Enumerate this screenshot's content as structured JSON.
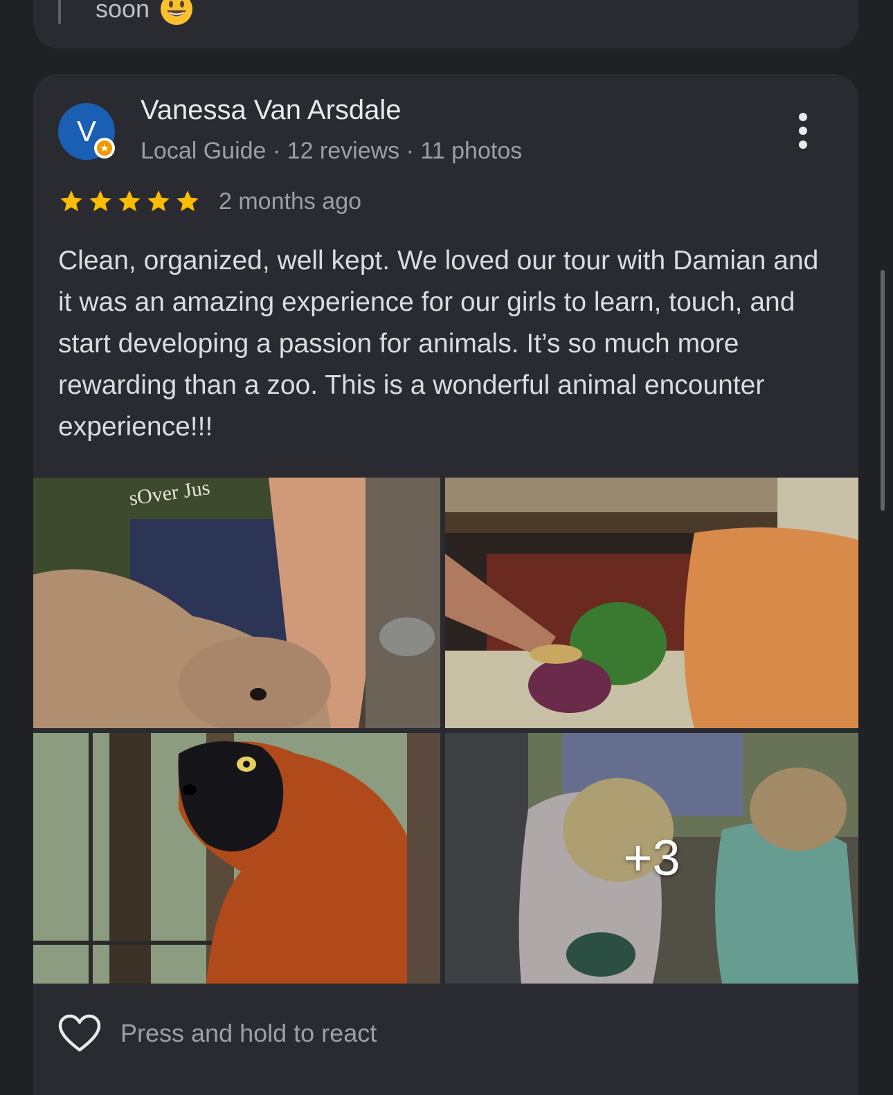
{
  "previous_review": {
    "text_tail": "soon",
    "emoji_icon": "smiling-face-icon"
  },
  "review": {
    "avatar_letter": "V",
    "avatar_color": "#1a5fb4",
    "reviewer_name": "Vanessa Van Arsdale",
    "reviewer_meta": "Local Guide · 12 reviews · 11 photos",
    "rating": 5,
    "rating_max": 5,
    "star_color": "#fbbc04",
    "date": "2 months ago",
    "text": "Clean, organized, well kept. We loved our tour with Damian and it was an amazing experience for our girls to learn, touch, and start developing a passion for animals. It’s so much more rewarding than a zoo. This is a wonderful animal encounter experience!!!",
    "photos": {
      "more_count_label": "+3"
    },
    "react_label": "Press and hold to react"
  }
}
